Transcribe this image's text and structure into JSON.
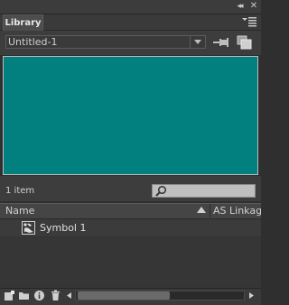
{
  "panel": {
    "tab_label": "Library",
    "collapse_glyph": "◂◂",
    "close_glyph": "✕"
  },
  "document": {
    "selected": "Untitled-1"
  },
  "preview": {
    "background_color": "#028080"
  },
  "status": {
    "item_count": "1 item",
    "search_value": ""
  },
  "columns": {
    "name": "Name",
    "linkage": "AS Linkag"
  },
  "items": [
    {
      "label": "Symbol 1",
      "icon": "movieclip-symbol-icon"
    }
  ],
  "bottom_toolbar": {
    "icons": [
      "new-symbol-icon",
      "new-folder-icon",
      "properties-icon",
      "delete-icon"
    ]
  }
}
